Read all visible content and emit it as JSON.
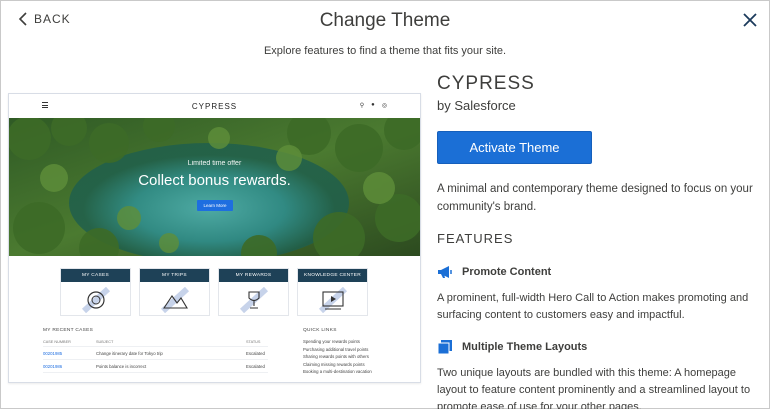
{
  "header": {
    "back_label": "BACK",
    "title": "Change Theme",
    "subtitle": "Explore features to find a theme that fits your site."
  },
  "preview": {
    "brand": "CYPRESS",
    "hero_small": "Limited time offer",
    "hero_big": "Collect bonus rewards.",
    "hero_button": "Learn More",
    "tiles": [
      "MY CASES",
      "MY TRIPS",
      "MY REWARDS",
      "KNOWLEDGE CENTER"
    ],
    "cases_title": "MY RECENT CASES",
    "cases_headers": [
      "CASE NUMBER",
      "SUBJECT",
      "STATUS"
    ],
    "cases_rows": [
      [
        "00201985",
        "Change itinerary date for Tokyo trip",
        "Escalated"
      ],
      [
        "00201986",
        "Points balance is incorrect",
        "Escalated"
      ]
    ],
    "links_title": "QUICK LINKS",
    "links": [
      "Spending your rewards points",
      "Purchasing additional travel points",
      "Sharing rewards points with others",
      "Claiming missing rewards points",
      "Booking a multi-destination vacation"
    ]
  },
  "theme": {
    "name": "CYPRESS",
    "by": "by Salesforce",
    "activate_label": "Activate Theme",
    "description": "A minimal and contemporary theme designed to focus on your community's brand.",
    "features_heading": "FEATURES",
    "features": [
      {
        "icon": "megaphone-icon",
        "title": "Promote Content",
        "description": "A prominent, full-width Hero Call to Action makes promoting and surfacing content to customers easy and impactful."
      },
      {
        "icon": "layouts-icon",
        "title": "Multiple Theme Layouts",
        "description": "Two unique layouts are bundled with this theme: A homepage layout to feature content prominently and a streamlined layout to promote ease of use for your other pages."
      }
    ]
  },
  "colors": {
    "accent": "#1b6fd6",
    "tile_header": "#1e4157"
  }
}
